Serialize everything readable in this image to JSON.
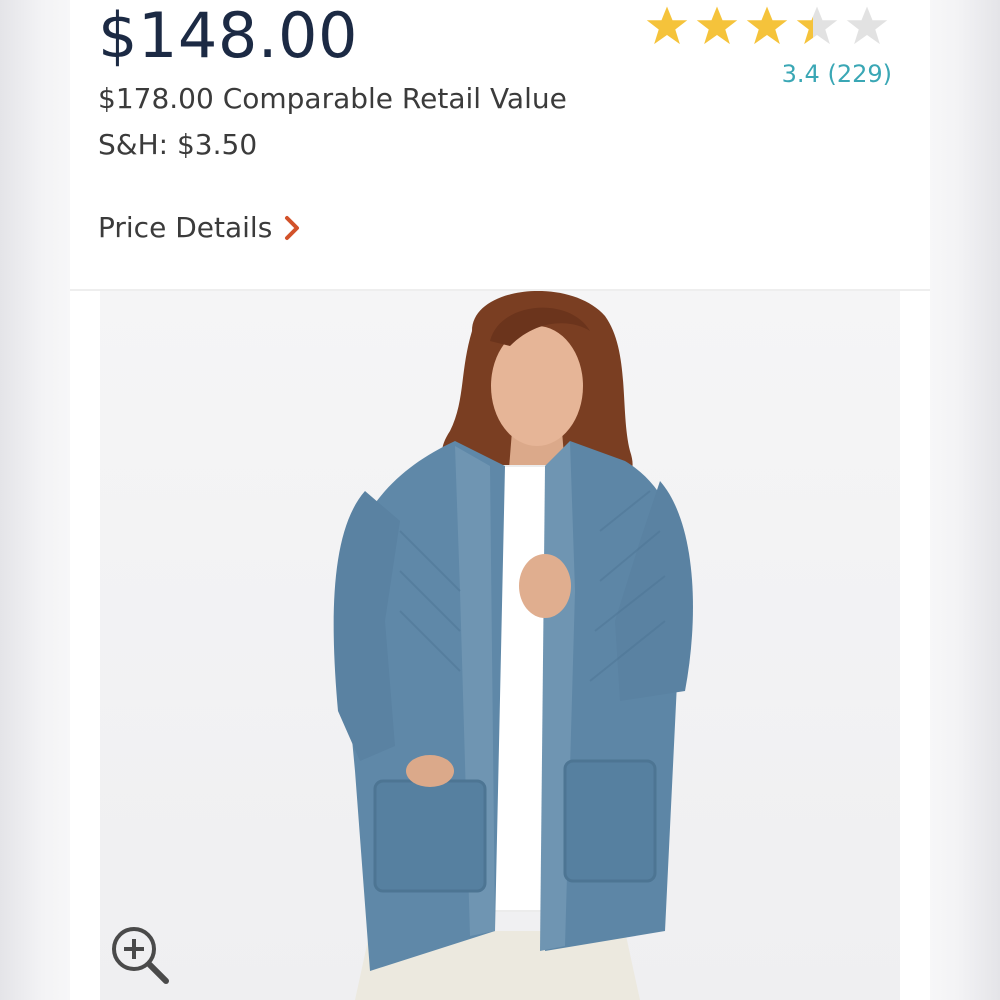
{
  "product": {
    "price": "$148.00",
    "retail_value": "$178.00 Comparable Retail Value",
    "shipping": "S&H: $3.50",
    "price_details_label": "Price Details"
  },
  "rating": {
    "value": 3.4,
    "stars_max": 5,
    "text": "3.4 (229)"
  },
  "image": {
    "subject": "woman wearing blue chenille open-front cardigan over white tee"
  },
  "icons": {
    "chevron": "chevron-right-icon",
    "zoom": "zoom-in-icon",
    "star": "star-icon"
  },
  "colors": {
    "price": "#1c2a44",
    "text": "#3b3b3b",
    "chevron": "#d2522a",
    "star_filled": "#f5c33b",
    "star_empty": "#e2e2e2",
    "rating_link": "#3aa7b5",
    "cardigan": "#5f88a8"
  }
}
